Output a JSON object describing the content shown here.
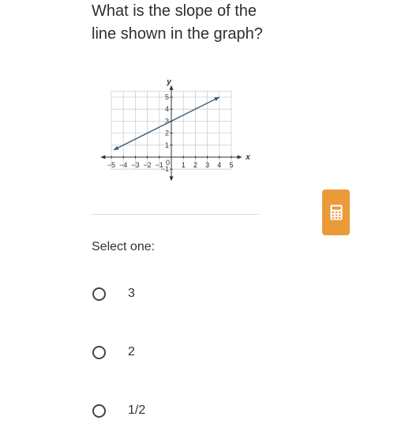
{
  "question": {
    "text": "What is the slope of the line shown in the graph?"
  },
  "graph": {
    "x_axis_label": "x",
    "y_axis_label": "y",
    "x_ticks": [
      "−5",
      "−4",
      "−3",
      "−2",
      "−1",
      "1",
      "2",
      "3",
      "4",
      "5"
    ],
    "y_ticks": [
      "1",
      "2",
      "3",
      "4",
      "5",
      "−1"
    ],
    "origin_label": "0",
    "line_color": "#3a5670",
    "chart_data": {
      "type": "line",
      "xlim": [
        -5,
        5
      ],
      "ylim": [
        -1,
        5
      ],
      "grid": true,
      "series": [
        {
          "name": "line",
          "x": [
            -4.8,
            4
          ],
          "y": [
            0.6,
            5
          ],
          "arrows": "both"
        }
      ]
    }
  },
  "calculator": {
    "icon": "calculator-icon",
    "color": "#eb9a3a"
  },
  "answers": {
    "prompt": "Select one:",
    "options": [
      {
        "label": "3",
        "selected": false
      },
      {
        "label": "2",
        "selected": false
      },
      {
        "label": "1/2",
        "selected": false
      }
    ]
  }
}
